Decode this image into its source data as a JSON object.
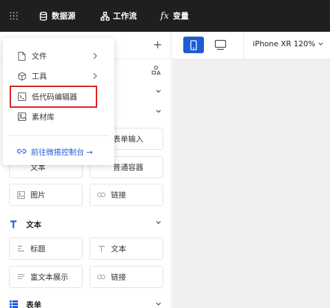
{
  "topbar": {
    "datasource_label": "数据源",
    "workflow_label": "工作流",
    "variables_icon_text": "fx",
    "variables_label": "变量"
  },
  "left_panel": {
    "add_label": "+",
    "hidden_cells": {
      "form_input_label": "表单输入",
      "text_label": "文本",
      "container_label": "普通容器"
    },
    "basic": {
      "image_label": "图片",
      "link_label": "链接"
    },
    "text_section": {
      "title": "文本",
      "items": [
        {
          "label": "标题",
          "icon": "heading-icon"
        },
        {
          "label": "文本",
          "icon": "text-icon"
        },
        {
          "label": "富文本展示",
          "icon": "rich-text-icon"
        },
        {
          "label": "链接",
          "icon": "link-icon"
        }
      ]
    },
    "form_section": {
      "title": "表单"
    }
  },
  "toolbar": {
    "device_label": "iPhone XR 120%"
  },
  "popup_menu": {
    "items": [
      {
        "label": "文件",
        "icon": "file-icon",
        "has_submenu": true
      },
      {
        "label": "工具",
        "icon": "cube-icon",
        "has_submenu": true
      },
      {
        "label": "低代码编辑器",
        "icon": "terminal-icon",
        "has_submenu": false
      },
      {
        "label": "素材库",
        "icon": "image-icon",
        "has_submenu": false
      }
    ],
    "console_link": "前往微搭控制台 →"
  },
  "colors": {
    "topbar_bg": "#1f1f1f",
    "accent": "#1e5bd7",
    "highlight": "#d41e1e",
    "canvas_bg": "#f0f0f0"
  }
}
